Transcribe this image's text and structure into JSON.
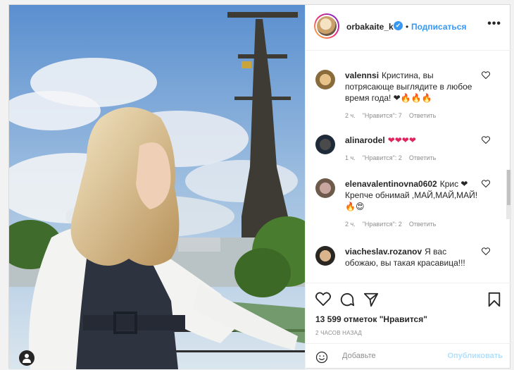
{
  "header": {
    "username": "orbakaite_k",
    "verified_mark": "✔",
    "separator": "•",
    "follow_label": "Подписаться",
    "more_label": "•••"
  },
  "comments": [
    {
      "username": "valennsi",
      "text": "Кристина, вы потрясающе выглядите в любое время года! ❤🔥🔥🔥",
      "time": "2 ч.",
      "likes": "\"Нравится\": 7",
      "reply": "Ответить"
    },
    {
      "username": "alinarodel",
      "text": "❤❤❤❤",
      "time": "1 ч.",
      "likes": "\"Нравится\": 2",
      "reply": "Ответить"
    },
    {
      "username": "elenavalentinovna0602",
      "text": "Крис ❤Крепче обнимай ,МАЙ,МАЙ,МАЙ!🔥😍",
      "time": "2 ч.",
      "likes": "\"Нравится\": 2",
      "reply": "Ответить"
    },
    {
      "username": "viacheslav.rozanov",
      "text": "Я вас обожаю, вы такая красавица!!!",
      "time": "",
      "likes": "",
      "reply": ""
    }
  ],
  "actions": {
    "likes_count": "13 599 отметок \"Нравится\"",
    "time_ago": "2 ЧАСОВ НАЗАД"
  },
  "add_comment": {
    "placeholder": "Добавьте",
    "publish_label": "Опубликовать"
  },
  "icons": [
    "user-icon",
    "more-icon",
    "heart-icon",
    "comment-icon",
    "share-icon",
    "bookmark-icon",
    "emoji-icon"
  ],
  "colors": {
    "link": "#3897f0",
    "muted": "#8e8e8e",
    "publish_disabled": "#b2dffc"
  }
}
